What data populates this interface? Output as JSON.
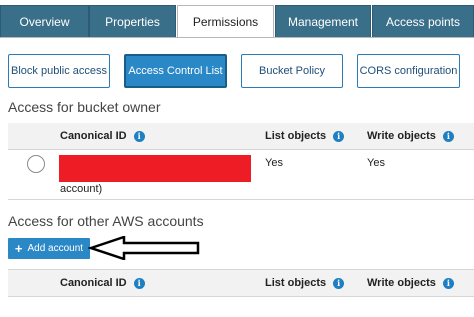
{
  "tabs": [
    {
      "label": "Overview",
      "active": false
    },
    {
      "label": "Properties",
      "active": false
    },
    {
      "label": "Permissions",
      "active": true
    },
    {
      "label": "Management",
      "active": false
    },
    {
      "label": "Access points",
      "active": false
    }
  ],
  "subtabs": [
    {
      "label": "Block public access",
      "active": false
    },
    {
      "label": "Access Control List",
      "active": true
    },
    {
      "label": "Bucket Policy",
      "active": false
    },
    {
      "label": "CORS configuration",
      "active": false
    }
  ],
  "owner_section": {
    "title": "Access for bucket owner",
    "columns": {
      "canonical_id": "Canonical ID",
      "list_objects": "List objects",
      "write_objects": "Write objects"
    },
    "row": {
      "canonical_id_suffix": "account)",
      "list_objects": "Yes",
      "write_objects": "Yes"
    }
  },
  "other_section": {
    "title": "Access for other AWS accounts",
    "add_button": "Add account",
    "columns": {
      "canonical_id": "Canonical ID",
      "list_objects": "List objects",
      "write_objects": "Write objects"
    }
  },
  "info_icon_glyph": "i",
  "colors": {
    "tab_bg": "#3a6f8a",
    "accent": "#2b88c7",
    "redaction": "#ee1c24"
  }
}
